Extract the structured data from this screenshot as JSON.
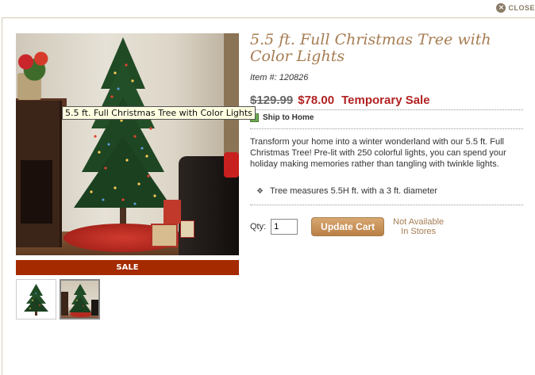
{
  "header": {
    "close_label": "CLOSE",
    "close_icon": "close-icon"
  },
  "product": {
    "title": "5.5 ft. Full Christmas Tree with Color Lights",
    "item_label": "Item #:",
    "item_number": "120826",
    "old_price": "$129.99",
    "new_price": "$78.00",
    "promo_label": "Temporary Sale",
    "ship_label": "Ship to Home",
    "description": "Transform your home into a winter wonderland with our 5.5 ft. Full Christmas Tree! Pre-lit with 250 colorful lights, you can spend your holiday making memories rather than tangling with twinkle lights.",
    "bullets": [
      "Tree measures 5.5H ft. with a 3 ft. diameter"
    ]
  },
  "image": {
    "tooltip": "5.5 ft. Full Christmas Tree with Color Lights",
    "sale_label": "SALE"
  },
  "cart": {
    "qty_label": "Qty:",
    "qty_value": "1",
    "update_label": "Update Cart",
    "availability_line1": "Not Available",
    "availability_line2": "In Stores"
  },
  "colors": {
    "accent": "#a67c52",
    "sale_bar": "#a52a00",
    "price": "#b22222"
  }
}
